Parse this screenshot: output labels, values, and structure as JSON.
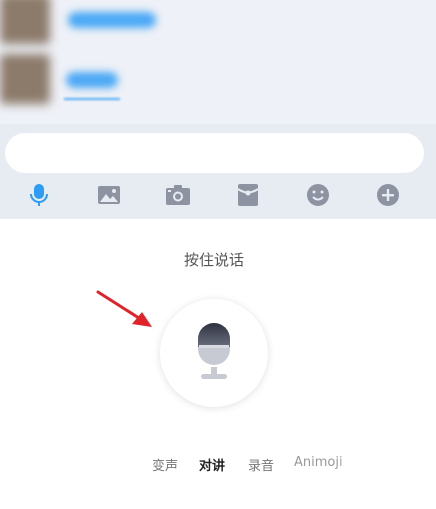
{
  "colors": {
    "accent": "#2d9cf5",
    "icon_gray": "#8d93a0",
    "panel_bg": "#e7ebf2",
    "chat_bg": "#eef1f7"
  },
  "toolbar": {
    "icons": [
      "microphone-icon",
      "image-icon",
      "camera-icon",
      "red-packet-icon",
      "emoji-icon",
      "plus-icon"
    ],
    "active": "microphone-icon"
  },
  "voice_panel": {
    "hint": "按住说话",
    "modes": [
      {
        "label": "变声",
        "active": false
      },
      {
        "label": "对讲",
        "active": true
      },
      {
        "label": "录音",
        "active": false
      },
      {
        "label": "Animoji",
        "active": false
      }
    ]
  }
}
